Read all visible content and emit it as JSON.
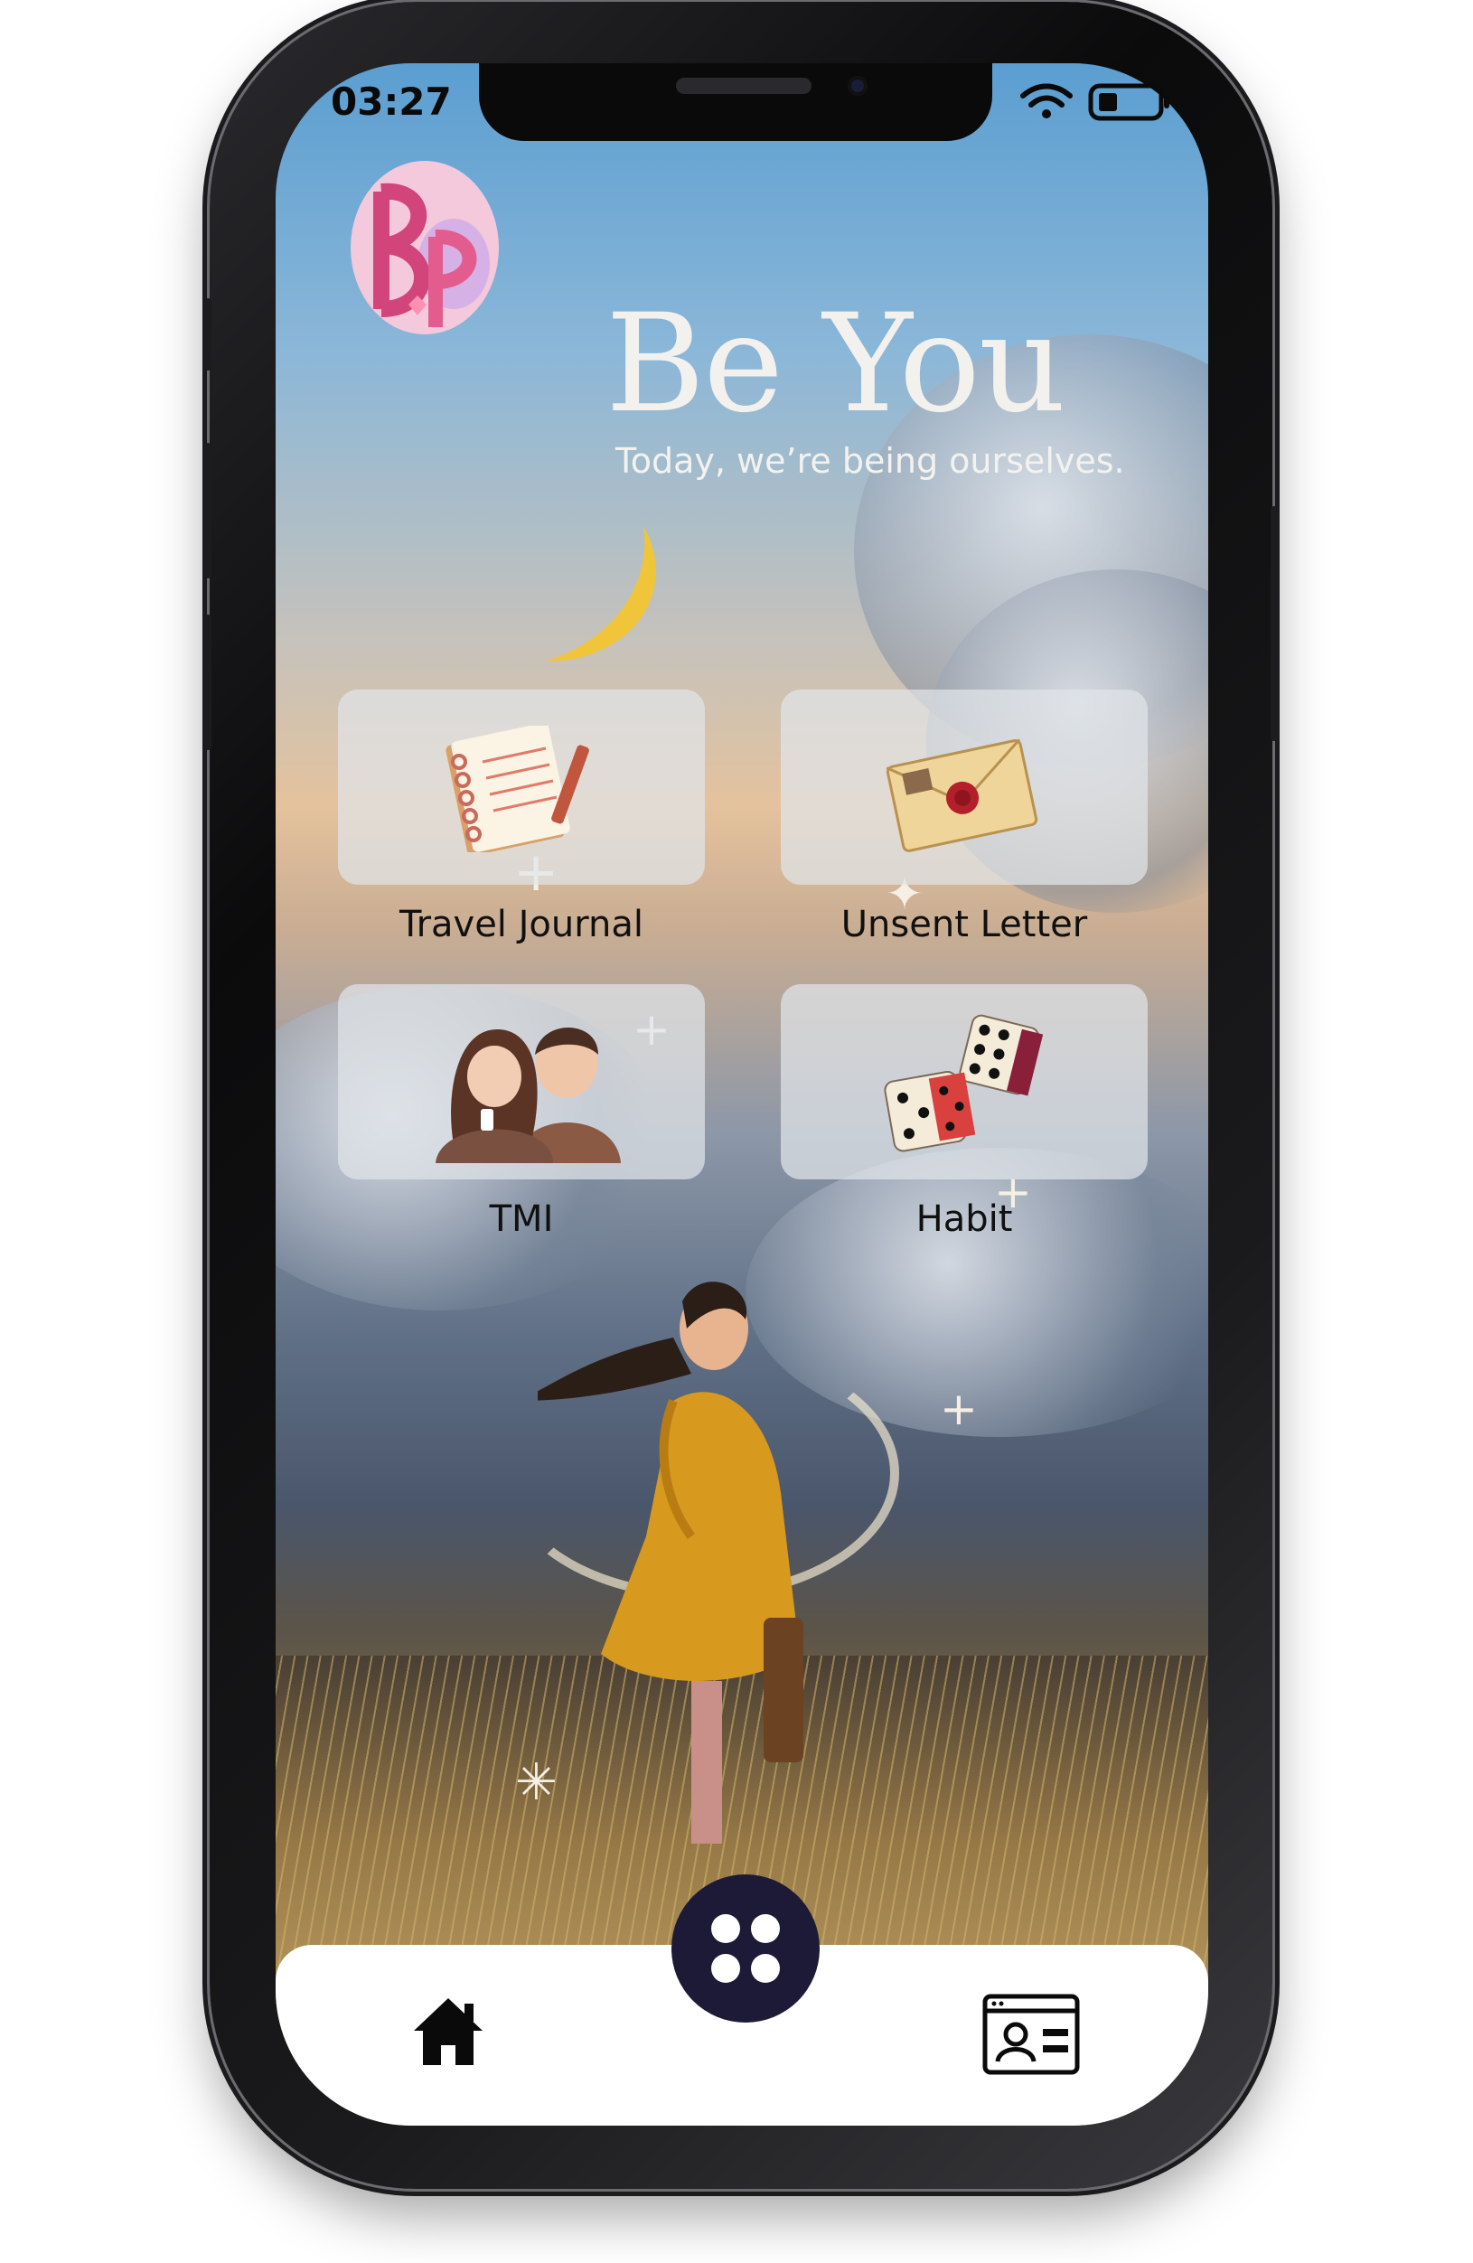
{
  "status_bar": {
    "time": "03:27"
  },
  "header": {
    "title": "Be You",
    "subtitle": "Today, we’re being ourselves."
  },
  "tiles": [
    {
      "label": "Travel Journal",
      "icon": "notebook-icon"
    },
    {
      "label": "Unsent Letter",
      "icon": "envelope-icon"
    },
    {
      "label": "TMI",
      "icon": "couple-icon"
    },
    {
      "label": "Habit",
      "icon": "dice-icon"
    }
  ],
  "nav": {
    "left_icon": "home-icon",
    "center_icon": "four-dots-icon",
    "right_icon": "profile-card-icon"
  },
  "colors": {
    "fab": "#1c1a36",
    "tile_bg": "#e1e4e9",
    "title_text": "#f3f1ee"
  }
}
